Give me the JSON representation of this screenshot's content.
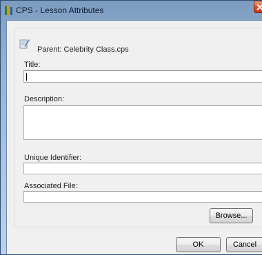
{
  "window": {
    "title": "CPS - Lesson Attributes"
  },
  "parent": {
    "text": "Parent: Celebrity Class.cps"
  },
  "fields": {
    "title_label": "Title:",
    "title_value": "",
    "description_label": "Description:",
    "description_value": "",
    "unique_identifier_label": "Unique Identifier:",
    "unique_identifier_value": "",
    "associated_file_label": "Associated File:",
    "associated_file_value": ""
  },
  "buttons": {
    "browse": "Browse...",
    "ok": "OK",
    "cancel": "Cancel"
  },
  "colors": {
    "title_bar": "#93b1d3",
    "close_button": "#d9552f",
    "client_background": "#f0f0f0"
  },
  "icons": {
    "app": "books-icon",
    "parent": "document-pen-icon",
    "close": "close-icon"
  }
}
